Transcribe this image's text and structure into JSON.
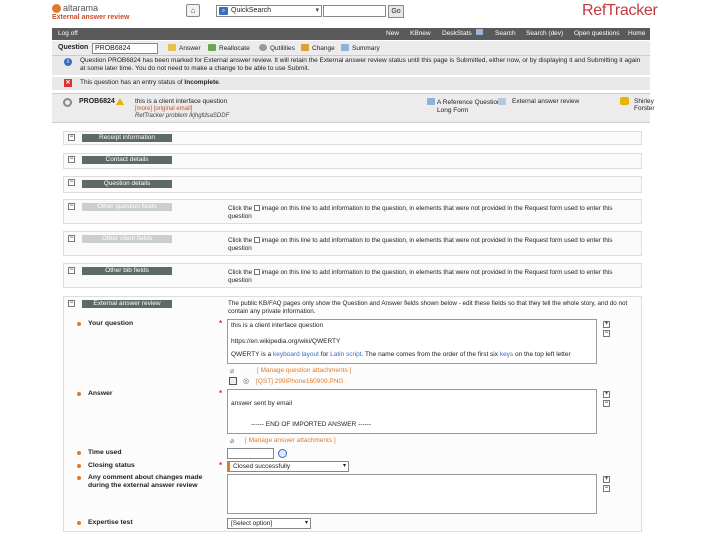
{
  "header": {
    "logo_text": "altarama",
    "logo_sub": "External answer review",
    "quicksearch_selected": "QuickSearch",
    "quicksearch_value": "",
    "go_label": "Go",
    "brand": "RefTracker"
  },
  "nav": {
    "logoff": "Log off",
    "items": [
      "New",
      "KBnew",
      "DeskStats",
      "Search",
      "Search (dev)",
      "Open questions",
      "Home"
    ]
  },
  "question_bar": {
    "label": "Question",
    "value": "PROB6824",
    "actions": [
      "Answer",
      "Reallocate",
      "Qutilities",
      "Change",
      "Summary"
    ]
  },
  "messages": {
    "info": "Question PROB6824 has been marked for External answer review. It will retain the External answer review status until this page is Submitted, either now, or by displaying it and Submitting it again at some later time. You do not need to make a change to be able to use Submit.",
    "error_pre": "This question has an entry status of ",
    "error_status": "Incomplete",
    "error_post": "."
  },
  "problem": {
    "id": "PROB6824",
    "description": "this is a client interface question",
    "links": "[more] [original email]",
    "subtitle": "RefTracker problem lkjhgfdsaSDDF",
    "format_line1": "A Reference Question -",
    "format_line2": "Long Form",
    "status": "External answer review",
    "user": "Shirley Forster"
  },
  "sections": {
    "receipt": "Receipt information",
    "contact": "Contact details",
    "question": "Question details",
    "other_question": "Other question fields",
    "other_client": "Other client fields",
    "other_bib": "Other bib fields",
    "ext_review": "External answer review",
    "click_pre": "Click the",
    "click_post": "image on this line to add information to the question, in elements that were not provided in the Request form used to enter this question",
    "ext_text": "The public KB/FAQ pages only show the Question and Answer fields shown below - edit these fields so that they tell the whole story, and do not contain any private information."
  },
  "form": {
    "your_question_label": "Your question",
    "your_question_l1": "this is a client interface question",
    "your_question_l2": "https://en.wikipedia.org/wiki/QWERTY",
    "your_question_l3_a": "QWERTY is a ",
    "your_question_l3_link1": "keyboard layout",
    "your_question_l3_b": " for ",
    "your_question_l3_link2": "Latin script",
    "your_question_l3_c": ". The name comes from the order of the first six ",
    "your_question_l3_link3": "keys",
    "your_question_l3_d": " on the top left letter",
    "manage_q_attach": "[ Manage question attachments ]",
    "attachment": "[QST] 299iPhone160909.PNG",
    "answer_label": "Answer",
    "answer_l1": "answer sent by email",
    "answer_l2": "------ END OF IMPORTED ANSWER ------",
    "manage_a_attach": "[ Manage answer attachments ]",
    "time_used_label": "Time used",
    "time_used_value": "",
    "closing_status_label": "Closing status",
    "closing_status_value": "Closed successfully",
    "comment_label_l1": "Any comment about changes made",
    "comment_label_l2": "during the external answer review",
    "comment_value": "",
    "expertise_label": "Expertise test",
    "expertise_value": "[Select option]"
  },
  "colors": {
    "accent_orange": "#e07b2a",
    "brand_red": "#c23a40",
    "nav_bg": "#5a5a5a",
    "section_title_bg": "#5e6b64",
    "link_blue": "#3a6cc0"
  }
}
